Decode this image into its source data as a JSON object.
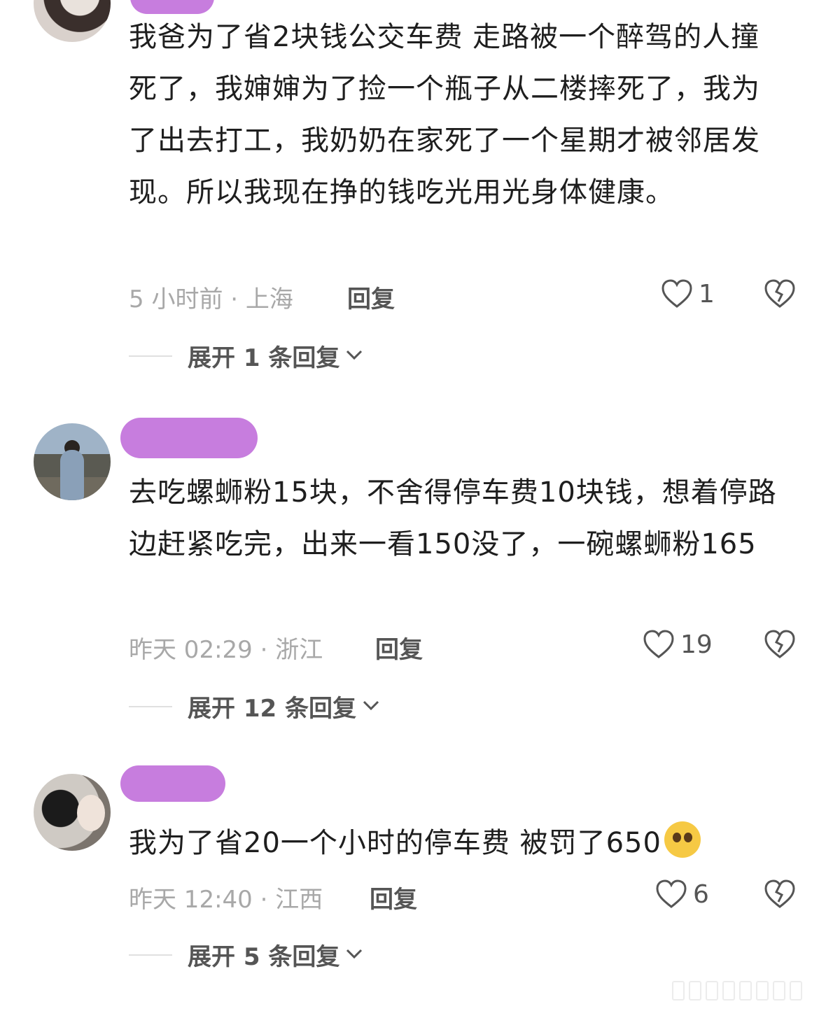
{
  "comments": [
    {
      "text": "我爸为了省2块钱公交车费 走路被一个醉驾的人撞死了，我婶婶为了捡一个瓶子从二楼摔死了，我为了出去打工，我奶奶在家死了一个星期才被邻居发现。所以我现在挣的钱吃光用光身体健康。",
      "meta": "5 小时前 · 上海",
      "reply_label": "回复",
      "likes": "1",
      "expand_label": "展开 1 条回复"
    },
    {
      "text": "去吃螺蛳粉15块，不舍得停车费10块钱，想着停路边赶紧吃完，出来一看150没了，一碗螺蛳粉165",
      "meta": "昨天 02:29 · 浙江",
      "reply_label": "回复",
      "likes": "19",
      "expand_label": "展开 12 条回复"
    },
    {
      "text": "我为了省20一个小时的停车费 被罚了650",
      "emoji": "crying-face-emoji",
      "meta": "昨天 12:40 · 江西",
      "reply_label": "回复",
      "likes": "6",
      "expand_label": "展开 5 条回复"
    }
  ],
  "colors": {
    "name_redaction": "#c77dde",
    "meta_text": "#a8a8a8",
    "body_text": "#1e1e1e"
  },
  "icons": [
    "heart-icon",
    "broken-heart-icon",
    "chevron-down-icon"
  ]
}
